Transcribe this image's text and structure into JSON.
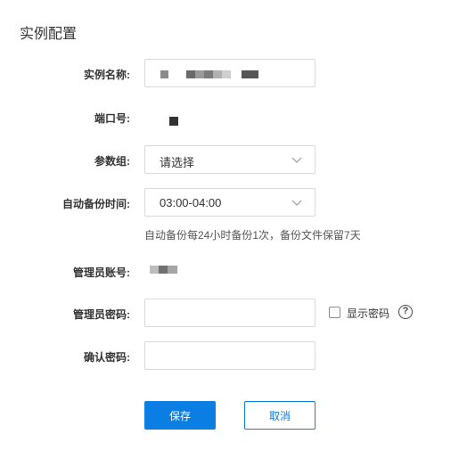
{
  "page": {
    "title": "实例配置"
  },
  "form": {
    "instance_name": {
      "label": "实例名称:"
    },
    "port": {
      "label": "端口号:"
    },
    "param_group": {
      "label": "参数组:",
      "value": "请选择"
    },
    "backup_time": {
      "label": "自动备份时间:",
      "value": "03:00-04:00"
    },
    "backup_hint": "自动备份每24小时备份1次，备份文件保留7天",
    "admin_account": {
      "label": "管理员账号:"
    },
    "admin_password": {
      "label": "管理员密码:",
      "value": ""
    },
    "show_password_label": "显示密码",
    "help_symbol": "?",
    "confirm_password": {
      "label": "确认密码:",
      "value": ""
    }
  },
  "actions": {
    "save_label": "保存",
    "cancel_label": "取消"
  },
  "colors": {
    "primary": "#0a7ee3",
    "border": "#d9d9d9",
    "text": "#333333"
  },
  "icons": {
    "dropdown": "chevron-down-icon",
    "help": "question-circle-icon"
  }
}
